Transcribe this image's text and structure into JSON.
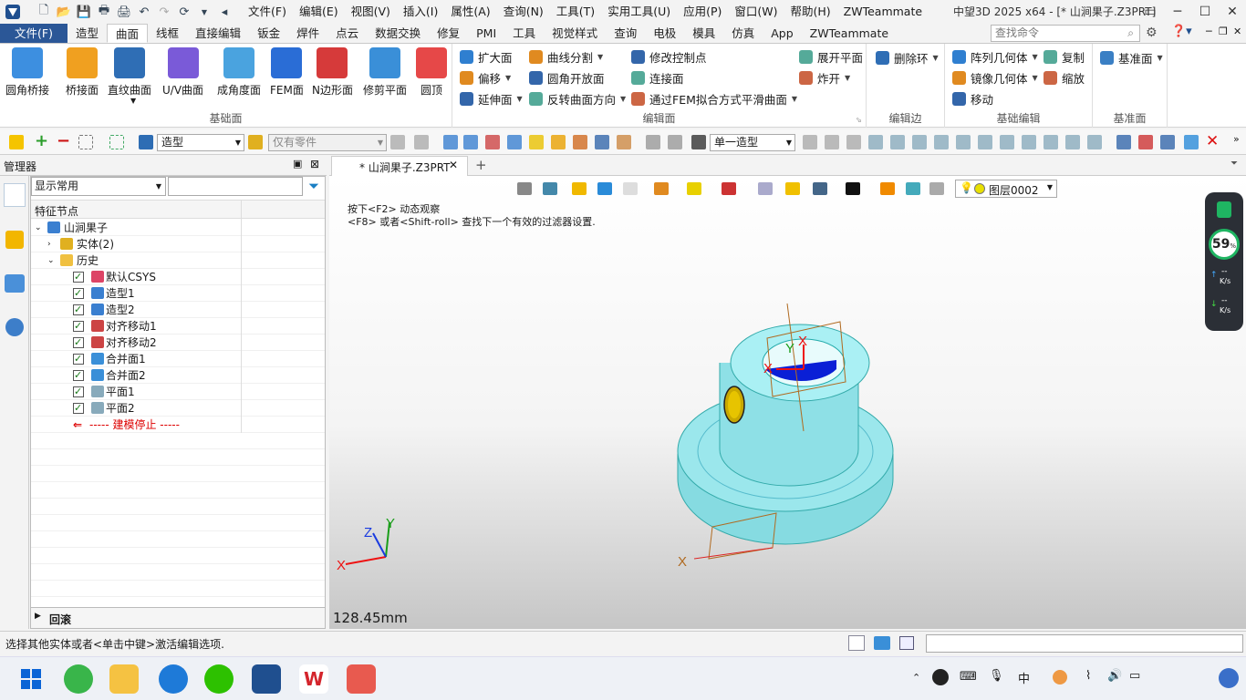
{
  "app": {
    "window_title": "中望3D 2025 x64 - [* 山涧果子.Z3PRT]"
  },
  "menu": [
    "文件(F)",
    "编辑(E)",
    "视图(V)",
    "插入(I)",
    "属性(A)",
    "查询(N)",
    "工具(T)",
    "实用工具(U)",
    "应用(P)",
    "窗口(W)",
    "帮助(H)",
    "ZWTeammate"
  ],
  "ribbon_tabs": [
    "文件(F)",
    "造型",
    "曲面",
    "线框",
    "直接编辑",
    "钣金",
    "焊件",
    "点云",
    "数据交换",
    "修复",
    "PMI",
    "工具",
    "视觉样式",
    "查询",
    "电极",
    "模具",
    "仿真",
    "App",
    "ZWTeammate"
  ],
  "active_tab": "曲面",
  "search_placeholder": "查找命令",
  "ribbon": {
    "basic_surface": {
      "title": "基础面",
      "buttons": [
        "圆角桥接",
        "桥接面",
        "直纹曲面",
        "U/V曲面",
        "成角度面",
        "FEM面",
        "N边形面",
        "修剪平面",
        "圆顶"
      ]
    },
    "edit_surface": {
      "title": "编辑面",
      "col1": [
        "扩大面",
        "偏移",
        "延伸面"
      ],
      "col2": [
        "曲线分割",
        "圆角开放面",
        "反转曲面方向"
      ],
      "col3": [
        "修改控制点",
        "连接面",
        "通过FEM拟合方式平滑曲面"
      ],
      "col4": [
        "展开平面",
        "炸开"
      ]
    },
    "edit_edge": {
      "title": "编辑边",
      "buttons": [
        "删除环"
      ]
    },
    "basic_edit": {
      "title": "基础编辑",
      "col1": [
        "阵列几何体",
        "镜像几何体",
        "移动"
      ],
      "col2": [
        "复制",
        "缩放"
      ]
    },
    "datum": {
      "title": "基准面",
      "buttons": [
        "基准面"
      ]
    }
  },
  "toolbar2": {
    "combo1": "造型",
    "combo2": "仅有零件",
    "combo3": "单一造型"
  },
  "manager": {
    "title": "管理器",
    "filter": "显示常用",
    "column_header": "特征节点",
    "root": "山涧果子",
    "nodes": [
      {
        "label": "实体(2)",
        "level": 1
      },
      {
        "label": "历史",
        "level": 1
      },
      {
        "label": "默认CSYS",
        "level": 2,
        "checked": true
      },
      {
        "label": "造型1",
        "level": 2,
        "checked": true
      },
      {
        "label": "造型2",
        "level": 2,
        "checked": true
      },
      {
        "label": "对齐移动1",
        "level": 2,
        "checked": true
      },
      {
        "label": "对齐移动2",
        "level": 2,
        "checked": true
      },
      {
        "label": "合并面1",
        "level": 2,
        "checked": true
      },
      {
        "label": "合并面2",
        "level": 2,
        "checked": true
      },
      {
        "label": "平面1",
        "level": 2,
        "checked": true
      },
      {
        "label": "平面2",
        "level": 2,
        "checked": true
      }
    ],
    "stop_marker": "----- 建模停止 -----",
    "footer": "回滚"
  },
  "viewport": {
    "doc_tab": "* 山涧果子.Z3PRT",
    "hint1": "按下<F2> 动态观察",
    "hint2": "<F8> 或者<Shift-roll> 查找下一个有效的过滤器设置.",
    "layer": "图层0002",
    "scale": "128.45mm",
    "axis_x": "X",
    "axis_y": "Y",
    "axis_z": "Z",
    "net_percent": "59",
    "net_unit": "%",
    "net_up": "--",
    "net_down": "--",
    "net_rate": "K/s"
  },
  "status": {
    "message": "选择其他实体或者<单击中键>激活编辑选项."
  },
  "colors": {
    "file_tab": "#2b5797",
    "part": "#9be7ec",
    "highlight": "#0a1fd6"
  }
}
